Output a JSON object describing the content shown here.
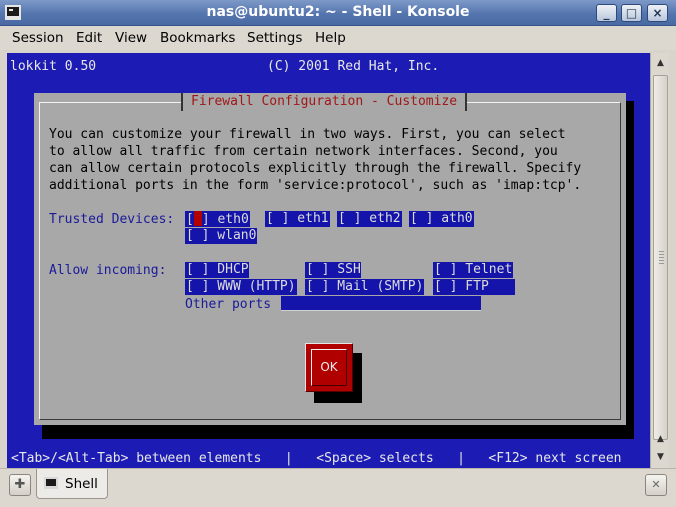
{
  "window": {
    "title": "nas@ubuntu2: ~ - Shell - Konsole",
    "minimize_icon": "minimize-icon",
    "maximize_icon": "maximize-icon",
    "close_icon": "close-icon"
  },
  "menubar": {
    "items": [
      "Session",
      "Edit",
      "View",
      "Bookmarks",
      "Settings",
      "Help"
    ]
  },
  "terminal": {
    "header_left": "lokkit 0.50",
    "header_center": "(C) 2001 Red Hat, Inc.",
    "background_color": "#1c1cb4",
    "dialog": {
      "title": "Firewall Configuration - Customize",
      "description_lines": [
        "You can customize your firewall in two ways. First, you can select",
        "to allow all traffic from certain network interfaces. Second, you",
        "can allow certain protocols explicitly through the firewall. Specify",
        "additional ports in the form 'service:protocol', such as 'imap:tcp'."
      ],
      "trusted_devices_label": "Trusted Devices:",
      "trusted_devices": [
        {
          "label": "[ ] eth0",
          "checked": false,
          "focused": true
        },
        {
          "label": "[ ] eth1",
          "checked": false
        },
        {
          "label": "[ ] eth2",
          "checked": false
        },
        {
          "label": "[ ] ath0",
          "checked": false
        },
        {
          "label": "[ ] wlan0",
          "checked": false
        }
      ],
      "allow_incoming_label": "Allow incoming:",
      "allow_incoming": [
        {
          "label": "[ ] DHCP",
          "checked": false
        },
        {
          "label": "[ ] SSH",
          "checked": false
        },
        {
          "label": "[ ] Telnet",
          "checked": false
        },
        {
          "label": "[ ] WWW (HTTP)",
          "checked": false
        },
        {
          "label": "[ ] Mail (SMTP)",
          "checked": false
        },
        {
          "label": "[ ] FTP",
          "checked": false
        }
      ],
      "other_ports_label": "Other ports",
      "other_ports_value": "",
      "ok_label": "OK"
    },
    "status_line": "<Tab>/<Alt-Tab> between elements   |   <Space> selects   |   <F12> next screen"
  },
  "tabbar": {
    "tabs": [
      {
        "label": "Shell",
        "icon": "terminal-icon"
      }
    ],
    "new_tab_icon": "new-tab-icon",
    "close_tab_icon": "close-tab-icon"
  }
}
